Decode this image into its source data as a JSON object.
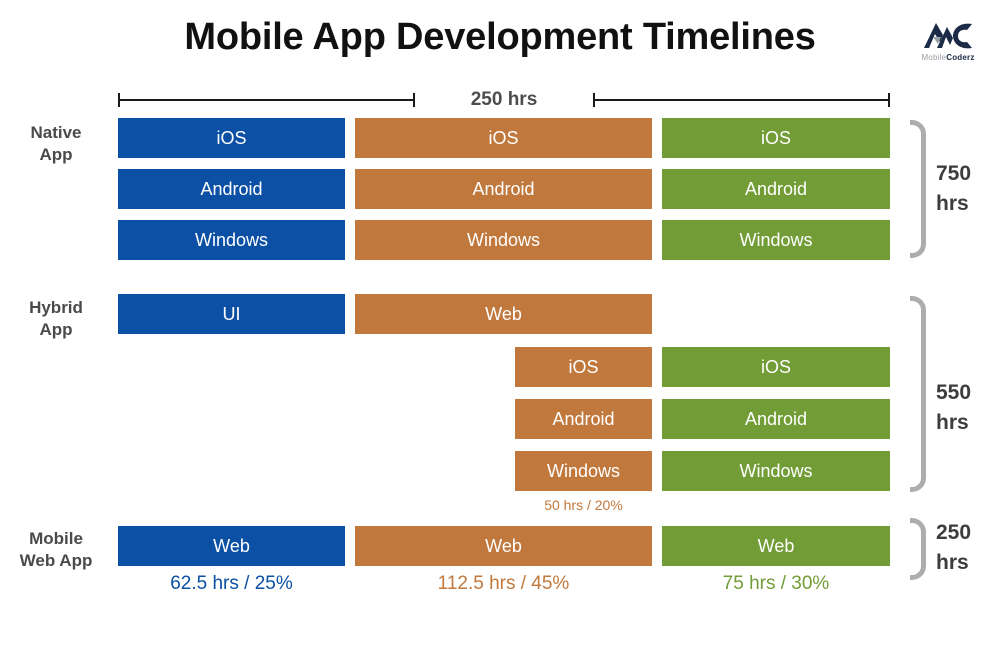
{
  "header": {
    "title": "Mobile App Development Timelines",
    "logo": {
      "name": "MobileCoderz",
      "word_a": "Mobile",
      "word_b": "Coderz",
      "mark_color": "#1b2a47"
    }
  },
  "scale": {
    "label": "250 hrs"
  },
  "colors": {
    "blue": "#0b50a4",
    "orange": "#c1783c",
    "green": "#729c36",
    "brace": "#adadad",
    "label": "#4a4a4a"
  },
  "rows": [
    {
      "id": "native-app",
      "label_line1": "Native",
      "label_line2": "App",
      "brace_value_line1": "750",
      "brace_value_line2": "hrs",
      "bars": [
        {
          "label": "iOS",
          "color": "blue"
        },
        {
          "label": "iOS",
          "color": "orange"
        },
        {
          "label": "iOS",
          "color": "green"
        },
        {
          "label": "Android",
          "color": "blue"
        },
        {
          "label": "Android",
          "color": "orange"
        },
        {
          "label": "Android",
          "color": "green"
        },
        {
          "label": "Windows",
          "color": "blue"
        },
        {
          "label": "Windows",
          "color": "orange"
        },
        {
          "label": "Windows",
          "color": "green"
        }
      ]
    },
    {
      "id": "hybrid-app",
      "label_line1": "Hybrid",
      "label_line2": "App",
      "brace_value_line1": "550",
      "brace_value_line2": "hrs",
      "bars": [
        {
          "label": "UI",
          "color": "blue"
        },
        {
          "label": "Web",
          "color": "orange"
        },
        {
          "label": "iOS",
          "color": "orange"
        },
        {
          "label": "iOS",
          "color": "green"
        },
        {
          "label": "Android",
          "color": "orange"
        },
        {
          "label": "Android",
          "color": "green"
        },
        {
          "label": "Windows",
          "color": "orange"
        },
        {
          "label": "Windows",
          "color": "green"
        }
      ],
      "caption": "50 hrs / 20%"
    },
    {
      "id": "mobile-web-app",
      "label_line1": "Mobile",
      "label_line2": "Web App",
      "brace_value_line1": "250",
      "brace_value_line2": "hrs",
      "bars": [
        {
          "label": "Web",
          "color": "blue"
        },
        {
          "label": "Web",
          "color": "orange"
        },
        {
          "label": "Web",
          "color": "green"
        }
      ],
      "captions": [
        "62.5 hrs / 25%",
        "112.5 hrs / 45%",
        "75 hrs / 30%"
      ]
    }
  ],
  "chart_data": {
    "type": "bar",
    "title": "Mobile App Development Timelines",
    "xlabel": "",
    "ylabel": "",
    "scale_unit": "250 hrs",
    "platform_series": [
      "iOS",
      "Android",
      "Windows"
    ],
    "color_tracks": [
      "blue",
      "orange",
      "green"
    ],
    "categories": [
      "Native App",
      "Hybrid App",
      "Mobile Web App"
    ],
    "totals_hrs": [
      750,
      550,
      250
    ],
    "totals_labels": [
      "750 hrs",
      "550 hrs",
      "250 hrs"
    ],
    "breakdown": [
      {
        "category": "Native App",
        "total_hrs": 750,
        "rows": [
          {
            "label": "iOS",
            "segments": [
              "blue",
              "orange",
              "green"
            ]
          },
          {
            "label": "Android",
            "segments": [
              "blue",
              "orange",
              "green"
            ]
          },
          {
            "label": "Windows",
            "segments": [
              "blue",
              "orange",
              "green"
            ]
          }
        ]
      },
      {
        "category": "Hybrid App",
        "total_hrs": 550,
        "rows": [
          {
            "label": "UI",
            "segments": [
              "blue"
            ]
          },
          {
            "label": "Web",
            "segments": [
              "orange"
            ]
          },
          {
            "label": "iOS",
            "segments": [
              "orange-half",
              "green"
            ]
          },
          {
            "label": "Android",
            "segments": [
              "orange-half",
              "green"
            ]
          },
          {
            "label": "Windows",
            "segments": [
              "orange-half",
              "green"
            ]
          }
        ],
        "annotation": "50 hrs / 20%"
      },
      {
        "category": "Mobile Web App",
        "total_hrs": 250,
        "rows": [
          {
            "label": "Web",
            "segments": [
              "blue",
              "orange",
              "green"
            ]
          }
        ],
        "annotations": [
          {
            "value_hrs": 62.5,
            "percent": 25,
            "text": "62.5 hrs / 25%",
            "color": "blue"
          },
          {
            "value_hrs": 112.5,
            "percent": 45,
            "text": "112.5 hrs / 45%",
            "color": "orange"
          },
          {
            "value_hrs": 75,
            "percent": 30,
            "text": "75 hrs / 30%",
            "color": "green"
          }
        ]
      }
    ]
  }
}
